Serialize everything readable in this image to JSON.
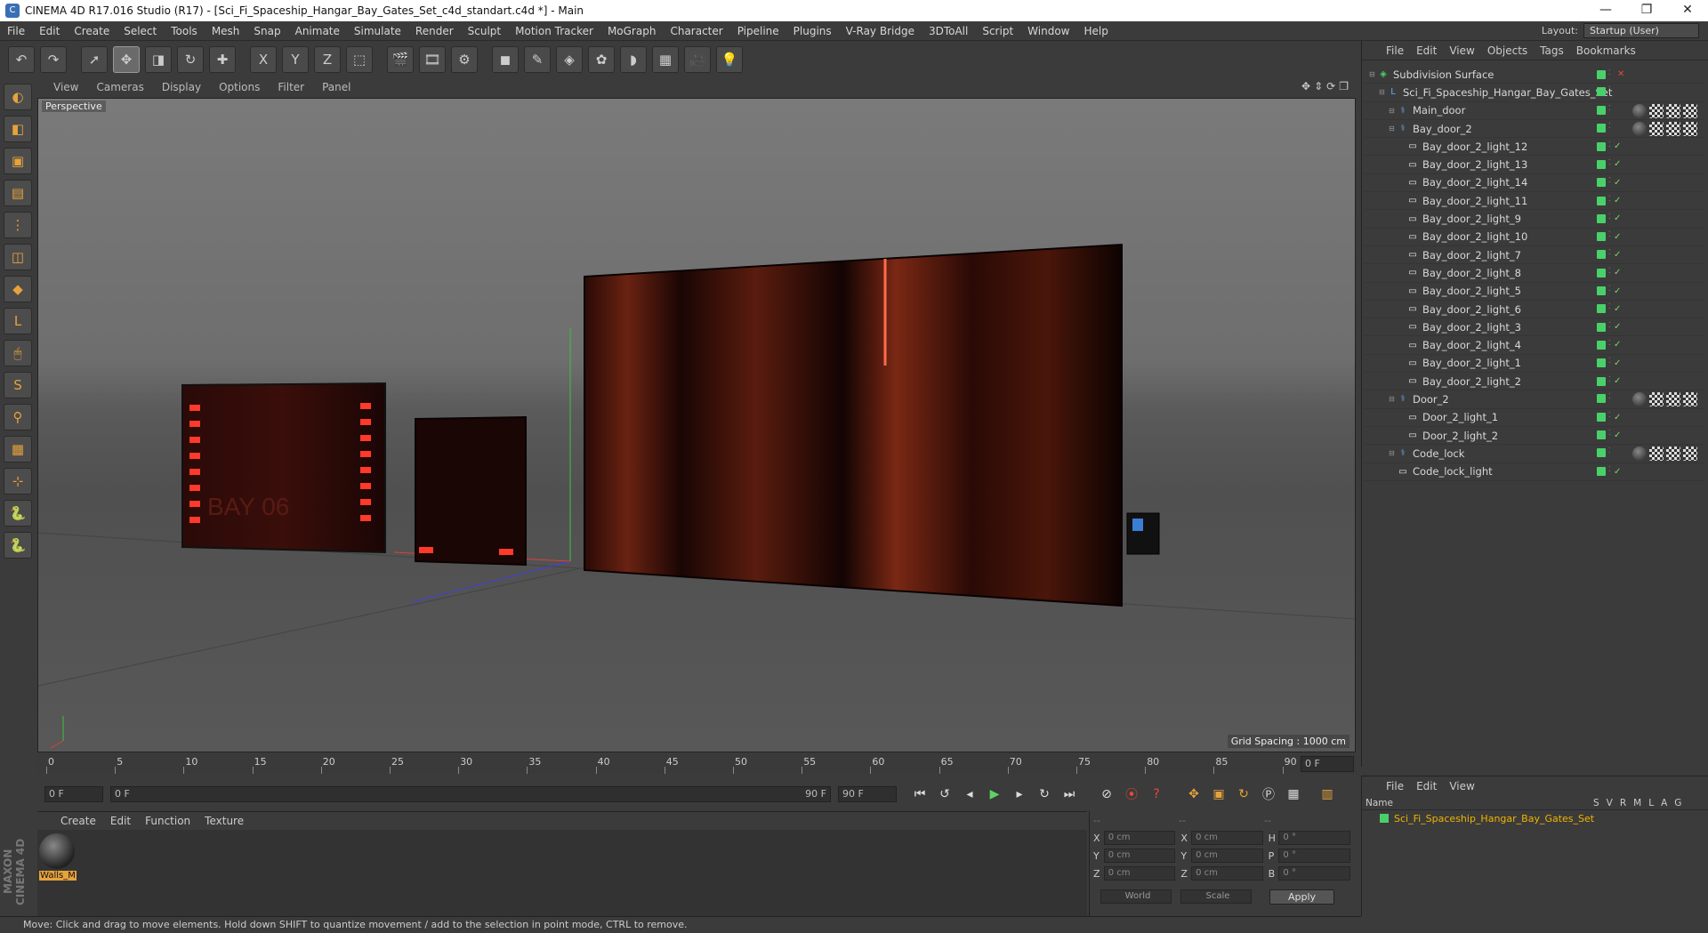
{
  "window": {
    "title": "CINEMA 4D R17.016 Studio (R17) - [Sci_Fi_Spaceship_Hangar_Bay_Gates_Set_c4d_standart.c4d *] - Main",
    "minimize": "—",
    "restore": "❐",
    "close": "✕"
  },
  "menu": [
    "File",
    "Edit",
    "Create",
    "Select",
    "Tools",
    "Mesh",
    "Snap",
    "Animate",
    "Simulate",
    "Render",
    "Sculpt",
    "Motion Tracker",
    "MoGraph",
    "Character",
    "Pipeline",
    "Plugins",
    "V-Ray Bridge",
    "3DToAll",
    "Script",
    "Window",
    "Help"
  ],
  "layout": {
    "label": "Layout:",
    "value": "Startup (User)"
  },
  "toolbar": [
    "undo-icon",
    "redo-icon",
    "select-cursor-icon",
    "move-icon",
    "scale-icon",
    "rotate-icon",
    "add-object-icon",
    "x-axis-icon",
    "y-axis-icon",
    "z-axis-icon",
    "coordinate-system-icon",
    "render-view-icon",
    "render-picture-viewer-icon",
    "edit-render-settings-icon",
    "cube-icon",
    "pen-icon",
    "subdivision-icon",
    "cloner-icon",
    "deformer-icon",
    "floor-icon",
    "camera-icon",
    "light-icon"
  ],
  "toolbar_glyphs": [
    "↶",
    "↷",
    "➚",
    "✥",
    "◨",
    "↻",
    "✚",
    "X",
    "Y",
    "Z",
    "⬚",
    "🎬",
    "🎞",
    "⚙",
    "◼",
    "✎",
    "◈",
    "✿",
    "◗",
    "▦",
    "🎥",
    "💡"
  ],
  "lefttools": [
    "sculpt-icon",
    "model-mode-icon",
    "texture-mode-icon",
    "workplane-icon",
    "points-mode-icon",
    "edges-mode-icon",
    "polygons-mode-icon",
    "axis-icon",
    "tweak-icon",
    "solo-icon",
    "magnet-icon",
    "grid-snap-icon",
    "enable-snap-icon",
    "python-icon",
    "python-script-icon"
  ],
  "lefttool_glyphs": [
    "◐",
    "◧",
    "▣",
    "▤",
    "⋮",
    "◫",
    "◆",
    "L",
    "🖱",
    "S",
    "⚲",
    "▦",
    "⊹",
    "🐍",
    "🐍"
  ],
  "viewport": {
    "menu": [
      "View",
      "Cameras",
      "Display",
      "Options",
      "Filter",
      "Panel"
    ],
    "label": "Perspective",
    "grid_spacing": "Grid Spacing : 1000 cm"
  },
  "timeline": {
    "ticks": [
      "0",
      "5",
      "10",
      "15",
      "20",
      "25",
      "30",
      "35",
      "40",
      "45",
      "50",
      "55",
      "60",
      "65",
      "70",
      "75",
      "80",
      "85",
      "90"
    ],
    "current_frame": "0 F"
  },
  "transport": {
    "start": "0 F",
    "range_start": "0 F",
    "range_end": "90 F",
    "end": "90 F"
  },
  "material_manager": {
    "menu": [
      "Create",
      "Edit",
      "Function",
      "Texture"
    ],
    "material_name": "Walls_M"
  },
  "coordinates": {
    "header": [
      "--",
      "--",
      "--"
    ],
    "rows": [
      {
        "a": "X",
        "v1": "0 cm",
        "b": "X",
        "v2": "0 cm",
        "c": "H",
        "v3": "0 °"
      },
      {
        "a": "Y",
        "v1": "0 cm",
        "b": "Y",
        "v2": "0 cm",
        "c": "P",
        "v3": "0 °"
      },
      {
        "a": "Z",
        "v1": "0 cm",
        "b": "Z",
        "v2": "0 cm",
        "c": "B",
        "v3": "0 °"
      }
    ],
    "world": "World",
    "scale": "Scale",
    "apply": "Apply"
  },
  "status": "Move: Click and drag to move elements. Hold down SHIFT to quantize movement / add to the selection in point mode, CTRL to remove.",
  "object_manager": {
    "menu": [
      "File",
      "Edit",
      "View",
      "Objects",
      "Tags",
      "Bookmarks"
    ],
    "objects": [
      {
        "name": "Subdivision Surface",
        "indent": 0,
        "icon": "subdivision-icon",
        "glyph": "◈",
        "color": "#4ad06a",
        "tags": 0
      },
      {
        "name": "Sci_Fi_Spaceship_Hangar_Bay_Gates_Set",
        "indent": 1,
        "icon": "null-icon",
        "glyph": "L",
        "color": "#6aa8e8",
        "tags": 0
      },
      {
        "name": "Main_door",
        "indent": 2,
        "icon": "bone-icon",
        "glyph": "⚕",
        "color": "#6aa8e8",
        "tags": 3
      },
      {
        "name": "Bay_door_2",
        "indent": 2,
        "icon": "bone-icon",
        "glyph": "⚕",
        "color": "#6aa8e8",
        "tags": 3
      },
      {
        "name": "Bay_door_2_light_12",
        "indent": 3,
        "icon": "object-icon",
        "glyph": "▭",
        "color": "#eee",
        "tags": 0
      },
      {
        "name": "Bay_door_2_light_13",
        "indent": 3,
        "icon": "object-icon",
        "glyph": "▭",
        "color": "#eee",
        "tags": 0
      },
      {
        "name": "Bay_door_2_light_14",
        "indent": 3,
        "icon": "object-icon",
        "glyph": "▭",
        "color": "#eee",
        "tags": 0
      },
      {
        "name": "Bay_door_2_light_11",
        "indent": 3,
        "icon": "object-icon",
        "glyph": "▭",
        "color": "#eee",
        "tags": 0
      },
      {
        "name": "Bay_door_2_light_9",
        "indent": 3,
        "icon": "object-icon",
        "glyph": "▭",
        "color": "#eee",
        "tags": 0
      },
      {
        "name": "Bay_door_2_light_10",
        "indent": 3,
        "icon": "object-icon",
        "glyph": "▭",
        "color": "#eee",
        "tags": 0
      },
      {
        "name": "Bay_door_2_light_7",
        "indent": 3,
        "icon": "object-icon",
        "glyph": "▭",
        "color": "#eee",
        "tags": 0
      },
      {
        "name": "Bay_door_2_light_8",
        "indent": 3,
        "icon": "object-icon",
        "glyph": "▭",
        "color": "#eee",
        "tags": 0
      },
      {
        "name": "Bay_door_2_light_5",
        "indent": 3,
        "icon": "object-icon",
        "glyph": "▭",
        "color": "#eee",
        "tags": 0
      },
      {
        "name": "Bay_door_2_light_6",
        "indent": 3,
        "icon": "object-icon",
        "glyph": "▭",
        "color": "#eee",
        "tags": 0
      },
      {
        "name": "Bay_door_2_light_3",
        "indent": 3,
        "icon": "object-icon",
        "glyph": "▭",
        "color": "#eee",
        "tags": 0
      },
      {
        "name": "Bay_door_2_light_4",
        "indent": 3,
        "icon": "object-icon",
        "glyph": "▭",
        "color": "#eee",
        "tags": 0
      },
      {
        "name": "Bay_door_2_light_1",
        "indent": 3,
        "icon": "object-icon",
        "glyph": "▭",
        "color": "#eee",
        "tags": 0
      },
      {
        "name": "Bay_door_2_light_2",
        "indent": 3,
        "icon": "object-icon",
        "glyph": "▭",
        "color": "#eee",
        "tags": 0
      },
      {
        "name": "Door_2",
        "indent": 2,
        "icon": "bone-icon",
        "glyph": "⚕",
        "color": "#6aa8e8",
        "tags": 3
      },
      {
        "name": "Door_2_light_1",
        "indent": 3,
        "icon": "object-icon",
        "glyph": "▭",
        "color": "#eee",
        "tags": 0
      },
      {
        "name": "Door_2_light_2",
        "indent": 3,
        "icon": "object-icon",
        "glyph": "▭",
        "color": "#eee",
        "tags": 0
      },
      {
        "name": "Code_lock",
        "indent": 2,
        "icon": "bone-icon",
        "glyph": "⚕",
        "color": "#6aa8e8",
        "tags": 3
      },
      {
        "name": "Code_lock_light",
        "indent": 2,
        "icon": "object-icon",
        "glyph": "▭",
        "color": "#eee",
        "tags": 0
      }
    ]
  },
  "attribute_manager": {
    "menu": [
      "File",
      "Edit",
      "View"
    ],
    "header": {
      "name": "Name",
      "cols": [
        "S",
        "V",
        "R",
        "M",
        "L",
        "A",
        "G"
      ]
    },
    "row": "Sci_Fi_Spaceship_Hangar_Bay_Gates_Set"
  }
}
